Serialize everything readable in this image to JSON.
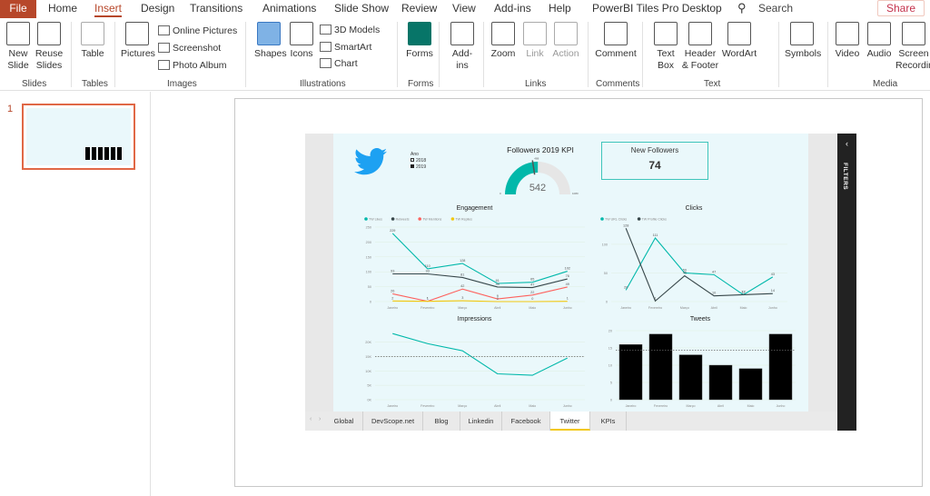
{
  "menu": {
    "file": "File",
    "tabs": [
      "Home",
      "Insert",
      "Design",
      "Transitions",
      "Animations",
      "Slide Show",
      "Review",
      "View",
      "Add-ins",
      "Help",
      "PowerBI Tiles Pro Desktop"
    ],
    "active": "Insert",
    "search": "Search",
    "share": "Share"
  },
  "ribbon": {
    "buttons": [
      {
        "label": "New Slide",
        "id": "new-slide"
      },
      {
        "label": "Reuse Slides",
        "id": "reuse-slides"
      },
      {
        "label": "Table",
        "id": "table"
      },
      {
        "label": "Pictures",
        "id": "pictures"
      },
      {
        "label": "Shapes",
        "id": "shapes"
      },
      {
        "label": "Icons",
        "id": "icons"
      },
      {
        "label": "Forms",
        "id": "forms"
      },
      {
        "label": "Add-ins",
        "id": "add-ins"
      },
      {
        "label": "Zoom",
        "id": "zoom"
      },
      {
        "label": "Link",
        "id": "link"
      },
      {
        "label": "Action",
        "id": "action"
      },
      {
        "label": "Comment",
        "id": "comment"
      },
      {
        "label": "Text Box",
        "id": "text-box"
      },
      {
        "label": "Header & Footer",
        "id": "header-footer"
      },
      {
        "label": "WordArt",
        "id": "wordart"
      },
      {
        "label": "Symbols",
        "id": "symbols"
      },
      {
        "label": "Video",
        "id": "video"
      },
      {
        "label": "Audio",
        "id": "audio"
      },
      {
        "label": "Screen Recording",
        "id": "screen-recording"
      }
    ],
    "small": [
      "Online Pictures",
      "Screenshot",
      "Photo Album",
      "3D Models",
      "SmartArt",
      "Chart"
    ],
    "groups": [
      "Slides",
      "Tables",
      "Images",
      "Illustrations",
      "Forms",
      "Links",
      "Comments",
      "Text",
      "Media"
    ]
  },
  "thumbnail": {
    "number": "1"
  },
  "report": {
    "legend": {
      "title": "Ano",
      "items": [
        "2018",
        "2019"
      ]
    },
    "kpi": {
      "title": "Followers 2019 KPI",
      "value": "542",
      "min": "0",
      "max": "1080",
      "target": "488",
      "value_num": 542,
      "max_num": 1080,
      "target_num": 488
    },
    "new_followers": {
      "title": "New Followers",
      "value": "74"
    },
    "filters": "FILTERS",
    "tabs": [
      "Global",
      "DevScope.net",
      "Blog",
      "Linkedin",
      "Facebook",
      "Twitter",
      "KPIs"
    ],
    "active_tab": "Twitter",
    "colors": {
      "accent": "#01b8aa",
      "twitter": "#1da1f2",
      "dark": "#374649",
      "red": "#fd625e",
      "yellow": "#f2c80f"
    }
  },
  "chart_data": [
    {
      "id": "engagement",
      "type": "line",
      "title": "Engagement",
      "categories": [
        "Janeiro",
        "Fevereiro",
        "Março",
        "Abril",
        "Maio",
        "Junho"
      ],
      "ylim": [
        0,
        250
      ],
      "yticks": [
        0,
        50,
        100,
        150,
        200,
        250
      ],
      "series": [
        {
          "name": "TW Likes",
          "color": "#01b8aa",
          "values": [
            229,
            110,
            128,
            61,
            65,
            102
          ]
        },
        {
          "name": "Retweets",
          "color": "#374649",
          "values": [
            93,
            93,
            81,
            49,
            47,
            76
          ]
        },
        {
          "name": "TW Mentions",
          "color": "#fd625e",
          "values": [
            26,
            1,
            42,
            9,
            22,
            49
          ]
        },
        {
          "name": "TW Replies",
          "color": "#f2c80f",
          "values": [
            2,
            1,
            3,
            0,
            0,
            1
          ]
        }
      ]
    },
    {
      "id": "clicks",
      "type": "line",
      "title": "Clicks",
      "categories": [
        "Janeiro",
        "Fevereiro",
        "Março",
        "Abril",
        "Maio",
        "Junho"
      ],
      "ylim": [
        0,
        130
      ],
      "yticks": [
        0,
        50,
        100
      ],
      "series": [
        {
          "name": "TW URL Clicks",
          "color": "#01b8aa",
          "values": [
            20,
            111,
            50,
            47,
            12,
            43
          ]
        },
        {
          "name": "TW Profile Clicks",
          "color": "#374649",
          "values": [
            128,
            1,
            45,
            10,
            12,
            14
          ]
        }
      ]
    },
    {
      "id": "impressions",
      "type": "line",
      "title": "Impressions",
      "categories": [
        "Janeiro",
        "Fevereiro",
        "Março",
        "Abril",
        "Maio",
        "Junho"
      ],
      "ylim": [
        0,
        24000
      ],
      "yticks": [
        0,
        5000,
        10000,
        15000,
        20000
      ],
      "ytick_labels": [
        "0K",
        "5K",
        "10K",
        "15K",
        "20K"
      ],
      "average": 15000,
      "series": [
        {
          "color": "#01b8aa",
          "values": [
            23000,
            19500,
            17000,
            9000,
            8500,
            14500
          ]
        }
      ]
    },
    {
      "id": "tweets",
      "type": "bar",
      "title": "Tweets",
      "categories": [
        "Janeiro",
        "Fevereiro",
        "Março",
        "Abril",
        "Maio",
        "Junho"
      ],
      "ylim": [
        0,
        20
      ],
      "yticks": [
        0,
        5,
        10,
        15,
        20
      ],
      "average": 14.3,
      "series": [
        {
          "color": "#000000",
          "values": [
            16,
            19,
            13,
            10,
            9,
            19
          ]
        }
      ]
    }
  ]
}
